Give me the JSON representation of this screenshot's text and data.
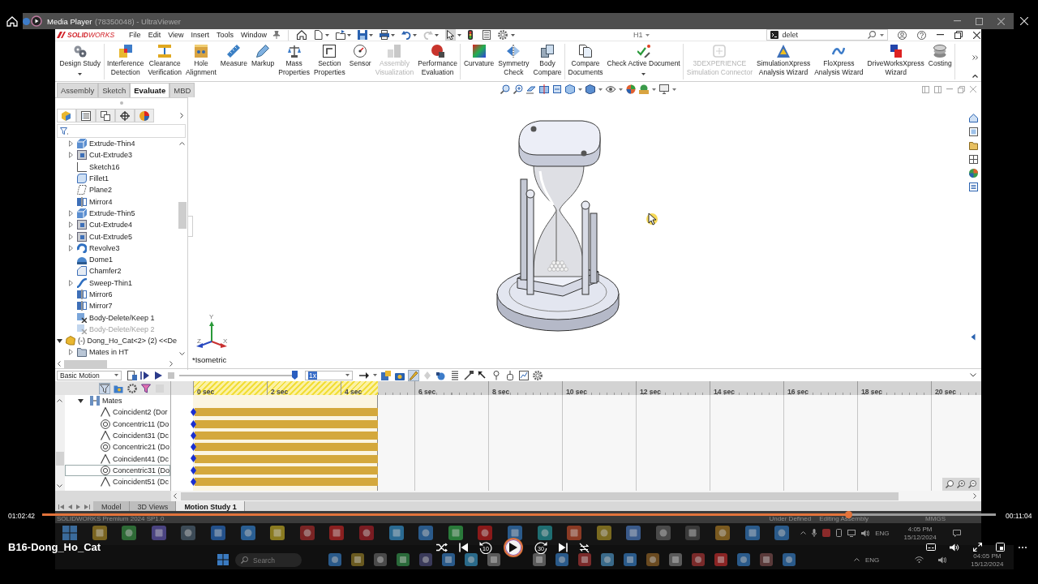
{
  "player": {
    "app_title": "Media Player",
    "elapsed": "01:02:42",
    "remaining": "00:11:04",
    "progress": {
      "level": 0.846
    },
    "video_title": "B16-Dong_Ho_Cat",
    "skip_back": "10",
    "skip_forward": "30"
  },
  "remote": {
    "title": "(78350048) - UltraViewer"
  },
  "app": {
    "logo": "**SOLID**WORKS",
    "menu": [
      "File",
      "Edit",
      "View",
      "Insert",
      "Tools",
      "Window"
    ],
    "text_style": "H1",
    "search": {
      "value": "delet"
    },
    "ribbon": [
      [
        {
          "lines": [
            "Design Study"
          ],
          "dropdown": true,
          "disabled": false
        }
      ],
      [
        {
          "lines": [
            "Interference",
            "Detection"
          ],
          "dropdown": false,
          "disabled": false
        },
        {
          "lines": [
            "Clearance",
            "Verification"
          ],
          "dropdown": false,
          "disabled": false
        },
        {
          "lines": [
            "Hole",
            "Alignment"
          ],
          "dropdown": false,
          "disabled": false
        },
        {
          "lines": [
            "Measure"
          ],
          "dropdown": false,
          "disabled": false
        },
        {
          "lines": [
            "Markup"
          ],
          "dropdown": false,
          "disabled": false
        },
        {
          "lines": [
            "Mass",
            "Properties"
          ],
          "dropdown": false,
          "disabled": false
        },
        {
          "lines": [
            "Section",
            "Properties"
          ],
          "dropdown": false,
          "disabled": false
        },
        {
          "lines": [
            "Sensor"
          ],
          "dropdown": false,
          "disabled": false
        },
        {
          "lines": [
            "Assembly",
            "Visualization"
          ],
          "dropdown": false,
          "disabled": true
        },
        {
          "lines": [
            "Performance",
            "Evaluation"
          ],
          "dropdown": false,
          "disabled": false
        }
      ],
      [
        {
          "lines": [
            "Curvature"
          ],
          "dropdown": false,
          "disabled": false
        },
        {
          "lines": [
            "Symmetry",
            "Check"
          ],
          "dropdown": false,
          "disabled": false
        },
        {
          "lines": [
            "Body",
            "Compare"
          ],
          "dropdown": false,
          "disabled": false
        }
      ],
      [
        {
          "lines": [
            "Compare",
            "Documents"
          ],
          "dropdown": false,
          "disabled": false
        },
        {
          "lines": [
            "Check Active Document"
          ],
          "dropdown": true,
          "disabled": false
        }
      ],
      [
        {
          "lines": [
            "3DEXPERIENCE",
            "Simulation Connector"
          ],
          "dropdown": false,
          "disabled": true
        },
        {
          "lines": [
            "SimulationXpress",
            "Analysis Wizard"
          ],
          "dropdown": false,
          "disabled": false
        },
        {
          "lines": [
            "FloXpress",
            "Analysis Wizard"
          ],
          "dropdown": false,
          "disabled": false
        },
        {
          "lines": [
            "DriveWorksXpress",
            "Wizard"
          ],
          "dropdown": false,
          "disabled": false
        },
        {
          "lines": [
            "Costing"
          ],
          "dropdown": false,
          "disabled": false
        }
      ]
    ],
    "tabs": [
      {
        "label": "Assembly",
        "selected": false
      },
      {
        "label": "Sketch",
        "selected": false
      },
      {
        "label": "Evaluate",
        "selected": true
      },
      {
        "label": "MBD",
        "selected": false
      }
    ],
    "panel_tabs": [
      {
        "selected": true
      },
      {
        "selected": false
      },
      {
        "selected": false
      },
      {
        "selected": false
      },
      {
        "selected": false
      }
    ],
    "tree": [
      {
        "children": [
          {
            "label": "Extrude-Thin4",
            "kind": "extrude",
            "expandable": true,
            "expanded": false,
            "suppressed": false
          },
          {
            "label": "Cut-Extrude3",
            "kind": "cut",
            "expandable": true,
            "expanded": false,
            "suppressed": false
          },
          {
            "label": "Sketch16",
            "kind": "sketch",
            "expandable": false,
            "suppressed": false
          },
          {
            "label": "Fillet1",
            "kind": "fillet",
            "expandable": false,
            "suppressed": false
          },
          {
            "label": "Plane2",
            "kind": "plane",
            "expandable": false,
            "suppressed": false
          },
          {
            "label": "Mirror4",
            "kind": "mirror",
            "expandable": false,
            "suppressed": false
          },
          {
            "label": "Extrude-Thin5",
            "kind": "extrude",
            "expandable": true,
            "expanded": false,
            "suppressed": false
          },
          {
            "label": "Cut-Extrude4",
            "kind": "cut",
            "expandable": true,
            "expanded": false,
            "suppressed": false
          },
          {
            "label": "Cut-Extrude5",
            "kind": "cut",
            "expandable": true,
            "expanded": false,
            "suppressed": false
          },
          {
            "label": "Revolve3",
            "kind": "revolve",
            "expandable": true,
            "expanded": false,
            "suppressed": false
          },
          {
            "label": "Dome1",
            "kind": "dome",
            "expandable": false,
            "suppressed": false
          },
          {
            "label": "Chamfer2",
            "kind": "chamfer",
            "expandable": false,
            "suppressed": false
          },
          {
            "label": "Sweep-Thin1",
            "kind": "sweep",
            "expandable": true,
            "expanded": false,
            "suppressed": false
          },
          {
            "label": "Mirror6",
            "kind": "mirror",
            "expandable": false,
            "suppressed": false
          },
          {
            "label": "Mirror7",
            "kind": "mirror",
            "expandable": false,
            "suppressed": false
          },
          {
            "label": "Body-Delete/Keep 1",
            "kind": "delete",
            "expandable": false,
            "suppressed": false
          },
          {
            "label": "Body-Delete/Keep 2",
            "kind": "delete",
            "expandable": false,
            "suppressed": true
          }
        ]
      },
      {
        "label": "(-) Dong_Ho_Cat<2> (2) <<De",
        "kind": "component",
        "expandable": true,
        "expanded": true,
        "suppressed": false,
        "children": [
          {
            "label": "Mates in HT",
            "kind": "folder",
            "expandable": true,
            "expanded": false,
            "suppressed": false
          }
        ]
      }
    ],
    "view_name": "*Isometric",
    "triad": {
      "y": "Y",
      "x": "X",
      "z": "Z"
    },
    "motion": {
      "study_type": "Basic Motion",
      "playback": {
        "level": 1
      },
      "speed": "1x",
      "ruler": [
        "0 sec",
        "2 sec",
        "4 sec",
        "6 sec",
        "8 sec",
        "10 sec",
        "12 sec",
        "14 sec",
        "16 sec",
        "18 sec",
        "20 sec"
      ],
      "duration": {
        "level": 0.235
      },
      "tree": [
        {
          "label": "Mates",
          "kind": "group",
          "expanded": true,
          "selected": false,
          "children": [
            {
              "label": "Coincident2 (Dor",
              "kind": "coincident",
              "selected": false
            },
            {
              "label": "Concentric11 (Do",
              "kind": "concentric",
              "selected": false
            },
            {
              "label": "Coincident31 (Dc",
              "kind": "coincident",
              "selected": false
            },
            {
              "label": "Concentric21 (Do",
              "kind": "concentric",
              "selected": false
            },
            {
              "label": "Coincident41 (Dc",
              "kind": "coincident",
              "selected": false
            },
            {
              "label": "Concentric31 (Do",
              "kind": "concentric",
              "selected": true
            },
            {
              "label": "Coincident51 (Dc",
              "kind": "coincident",
              "selected": false
            }
          ]
        }
      ],
      "tabs": [
        {
          "label": "Model",
          "selected": false
        },
        {
          "label": "3D Views",
          "selected": false
        },
        {
          "label": "Motion Study 1",
          "selected": true
        }
      ]
    },
    "status_bar": [
      "SOLIDWORKS Premium 2024 SP1.0",
      "Under Defined",
      "Editing Assembly",
      "MMGS"
    ]
  },
  "taskbar": {
    "top_tray": {
      "language": "ENG",
      "time": "4:05 PM",
      "date": "15/12/2024"
    },
    "search": {
      "placeholder": "Search"
    },
    "bottom_tray": {
      "language": "ENG",
      "time": "04:05 PM",
      "date": "15/12/2024"
    }
  }
}
